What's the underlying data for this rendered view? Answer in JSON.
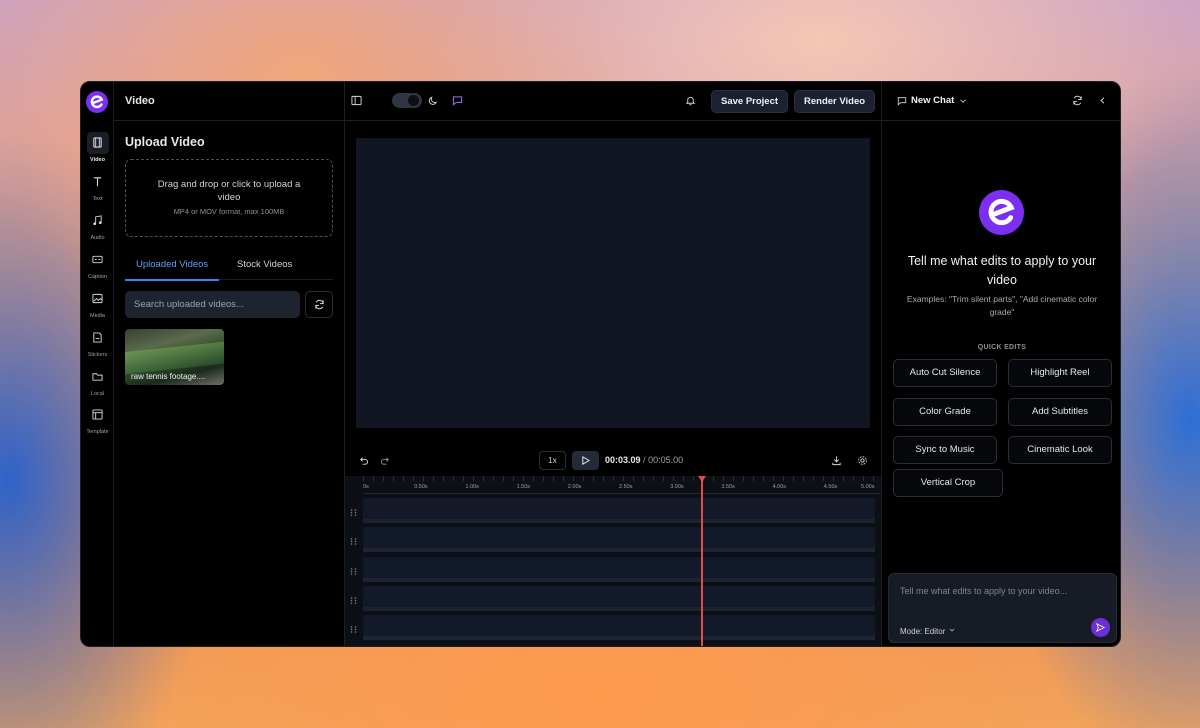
{
  "app": {
    "brand_color": "#7b2ff0",
    "accent_color": "#3b82f6",
    "playhead_color": "#e24b4b"
  },
  "rail": [
    {
      "label": "Video",
      "icon": "film-icon"
    },
    {
      "label": "Text",
      "icon": "text-icon"
    },
    {
      "label": "Audio",
      "icon": "music-icon"
    },
    {
      "label": "Caption",
      "icon": "caption-icon"
    },
    {
      "label": "Media",
      "icon": "image-icon"
    },
    {
      "label": "Stickers",
      "icon": "sticker-icon"
    },
    {
      "label": "Local",
      "icon": "folder-icon"
    },
    {
      "label": "Template",
      "icon": "template-icon"
    }
  ],
  "left_panel": {
    "header": "Video",
    "upload_title": "Upload Video",
    "dropzone_text": "Drag and drop or click to upload a video",
    "dropzone_hint": "MP4 or MOV format, max 100MB",
    "tabs": [
      "Uploaded Videos",
      "Stock Videos"
    ],
    "search_placeholder": "Search uploaded videos...",
    "videos": [
      {
        "name": "raw tennis footage...."
      }
    ]
  },
  "toolbar": {
    "save_label": "Save Project",
    "render_label": "Render Video"
  },
  "player": {
    "speed": "1x",
    "current_time": "00:03.09",
    "separator": "/",
    "duration": "00:05.00",
    "playhead_seconds": 3.3
  },
  "timeline": {
    "ticks": [
      "0s",
      "0.50s",
      "1.00s",
      "1.50s",
      "2.00s",
      "2.50s",
      "3.00s",
      "3.50s",
      "4.00s",
      "4.50s",
      "5.00s"
    ],
    "track_count": 5
  },
  "chat": {
    "title": "New Chat",
    "prompt_title": "Tell me what edits to apply to your video",
    "prompt_examples": "Examples: \"Trim silent parts\", \"Add cinematic color grade\"",
    "quick_edits_label": "QUICK EDITS",
    "quick_edits": [
      "Auto Cut Silence",
      "Highlight Reel",
      "Color Grade",
      "Add Subtitles",
      "Sync to Music",
      "Cinematic Look",
      "Vertical Crop"
    ],
    "input_placeholder": "Tell me what edits to apply to your video...",
    "mode_label": "Mode: Editor"
  }
}
